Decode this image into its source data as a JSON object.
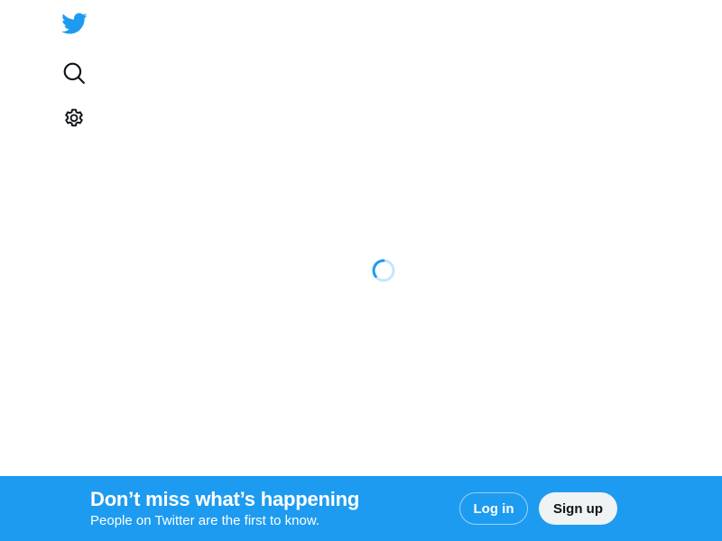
{
  "sidebar": {
    "logo_icon": "twitter-bird-icon",
    "items": [
      {
        "icon": "search-icon"
      },
      {
        "icon": "gear-icon"
      }
    ]
  },
  "main": {
    "loading_icon": "loading-spinner-icon"
  },
  "banner": {
    "title": "Don’t miss what’s happening",
    "subtitle": "People on Twitter are the first to know.",
    "login_label": "Log in",
    "signup_label": "Sign up"
  },
  "colors": {
    "brand": "#1d9bf0",
    "icon_dark": "#0f1419",
    "signup_bg": "#eff3f4"
  }
}
